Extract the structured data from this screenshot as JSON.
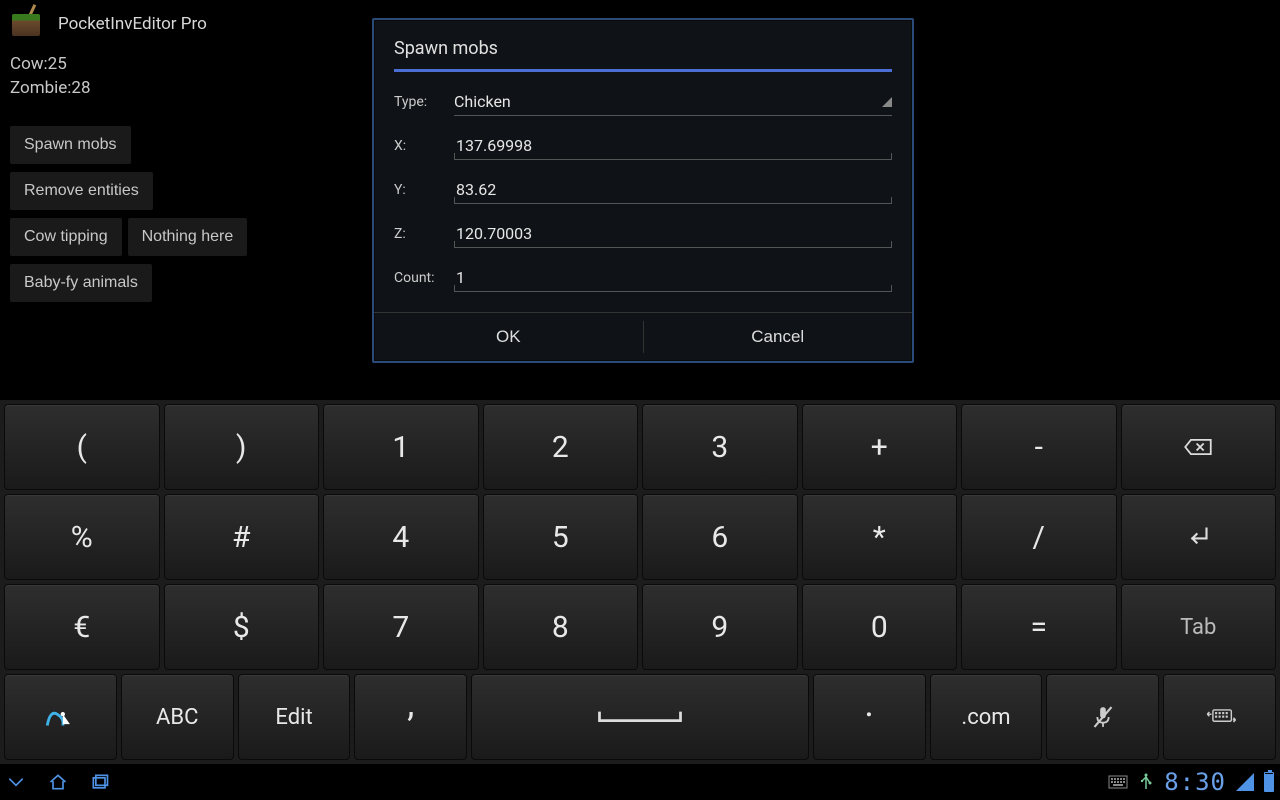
{
  "app": {
    "title": "PocketInvEditor Pro"
  },
  "mobs": [
    {
      "text": "Cow:25"
    },
    {
      "text": "Zombie:28"
    }
  ],
  "buttons": {
    "spawn": "Spawn mobs",
    "remove": "Remove entities",
    "cowtip": "Cow tipping",
    "nothing": "Nothing here",
    "babyfy": "Baby-fy animals"
  },
  "dialog": {
    "title": "Spawn mobs",
    "type_label": "Type:",
    "type_value": "Chicken",
    "x_label": "X:",
    "x_value": "137.69998",
    "y_label": "Y:",
    "y_value": "83.62",
    "z_label": "Z:",
    "z_value": "120.70003",
    "count_label": "Count:",
    "count_value": "1",
    "ok": "OK",
    "cancel": "Cancel"
  },
  "keyboard": {
    "row1": [
      "(",
      ")",
      "1",
      "2",
      "3",
      "+",
      "-"
    ],
    "row2": [
      "%",
      "#",
      "4",
      "5",
      "6",
      "*",
      "/"
    ],
    "row3": [
      "€",
      "$",
      "7",
      "8",
      "9",
      "0",
      "="
    ],
    "row4": {
      "abc": "ABC",
      "edit": "Edit",
      "comma": ",",
      "dot": ".",
      "com": ".com"
    },
    "tab": "Tab"
  },
  "status": {
    "time": "8:30"
  }
}
